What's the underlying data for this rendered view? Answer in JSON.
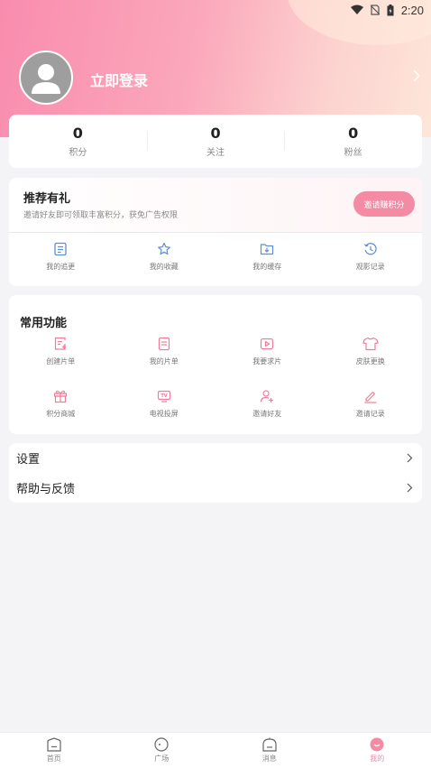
{
  "status_bar": {
    "time": "2:20"
  },
  "header": {
    "login_text": "立即登录"
  },
  "stats": [
    {
      "value": "0",
      "label": "积分"
    },
    {
      "value": "0",
      "label": "关注"
    },
    {
      "value": "0",
      "label": "粉丝"
    }
  ],
  "recommend": {
    "title": "推荐有礼",
    "desc": "邀请好友即可领取丰富积分，获免广告权限",
    "button": "邀请赚积分",
    "items": [
      {
        "label": "我的追更",
        "icon": "follow-list-icon"
      },
      {
        "label": "我的收藏",
        "icon": "star-icon"
      },
      {
        "label": "我的缓存",
        "icon": "download-folder-icon"
      },
      {
        "label": "观影记录",
        "icon": "history-icon"
      }
    ]
  },
  "functions": {
    "title": "常用功能",
    "items": [
      {
        "label": "创建片单",
        "icon": "create-list-icon"
      },
      {
        "label": "我的片单",
        "icon": "my-list-icon"
      },
      {
        "label": "我要求片",
        "icon": "play-request-icon"
      },
      {
        "label": "皮肤更换",
        "icon": "shirt-icon"
      },
      {
        "label": "积分商城",
        "icon": "gift-icon"
      },
      {
        "label": "电视投屏",
        "icon": "tv-cast-icon"
      },
      {
        "label": "邀请好友",
        "icon": "invite-user-icon"
      },
      {
        "label": "邀请记录",
        "icon": "edit-record-icon"
      }
    ]
  },
  "menu": [
    {
      "label": "设置"
    },
    {
      "label": "帮助与反馈"
    }
  ],
  "tabs": [
    {
      "label": "首页",
      "icon": "home-icon"
    },
    {
      "label": "广场",
      "icon": "square-icon"
    },
    {
      "label": "消息",
      "icon": "message-icon"
    },
    {
      "label": "我的",
      "icon": "mine-icon",
      "active": true
    }
  ],
  "colors": {
    "accent": "#f58aa5",
    "blue_icon": "#5b8fd6",
    "pink_icon": "#ef7d9a"
  }
}
